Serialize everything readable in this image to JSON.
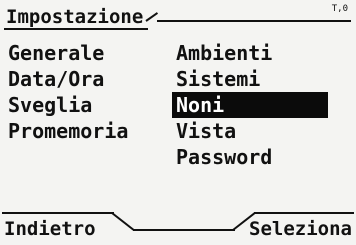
{
  "header": {
    "title": "Impostazione",
    "indicator": "T,0"
  },
  "left_menu": {
    "items": [
      "Generale",
      "Data/Ora",
      "Sveglia",
      "Promemoria"
    ]
  },
  "right_menu": {
    "items": [
      "Ambienti",
      "Sistemi",
      "Noni",
      "Vista",
      "Password"
    ],
    "selected_index": 2
  },
  "softkeys": {
    "left_label": "Indietro",
    "right_label": "Seleziona"
  }
}
